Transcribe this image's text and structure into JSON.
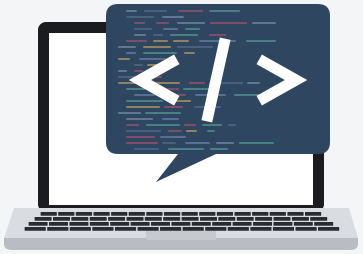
{
  "illustration": {
    "code_symbol": "</>",
    "icon_name": "code-speech-bubble-laptop",
    "colors": {
      "bubble": "#2f4660",
      "bubble_light": "#3c5572",
      "symbol": "#ffffff",
      "laptop_frame": "#1c1c20",
      "screen": "#ffffff",
      "keyboard_deck": "#d9dce0",
      "keys": "#2a2c31",
      "background": "#f4f5f7"
    },
    "code_line_colors": [
      "#5f7894",
      "#8aa0b8",
      "#c0566d",
      "#5fb0a0",
      "#e0b45a",
      "#7b8fbd"
    ]
  }
}
